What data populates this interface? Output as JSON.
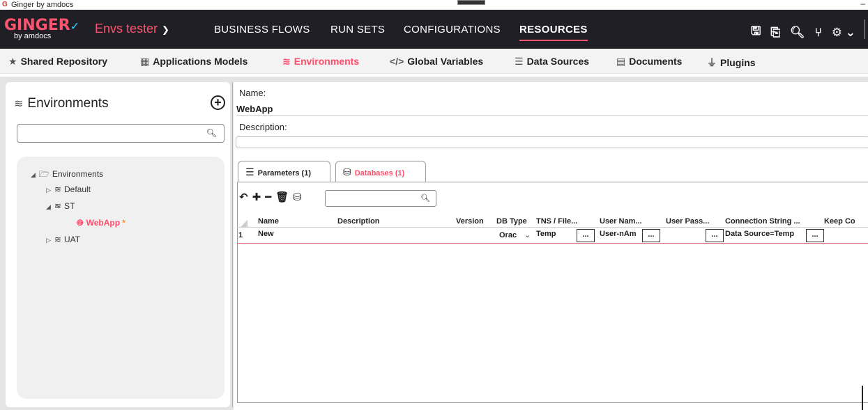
{
  "window": {
    "title": "Ginger by amdocs",
    "minimize": "–"
  },
  "brand": {
    "name": "GINGER",
    "tagline": "by amdocs"
  },
  "env_selector": {
    "value": "Envs tester"
  },
  "main_nav": {
    "items": [
      "BUSINESS FLOWS",
      "RUN SETS",
      "CONFIGURATIONS",
      "RESOURCES"
    ],
    "active": "RESOURCES"
  },
  "sub_nav": {
    "items": [
      "Shared Repository",
      "Applications Models",
      "Environments",
      "Global  Variables",
      "Data Sources",
      "Documents",
      "Plugins"
    ],
    "active": "Environments"
  },
  "left_panel": {
    "title": "Environments",
    "search_placeholder": "",
    "tree": {
      "root": "Environments",
      "children": [
        "Default",
        "ST",
        "WebApp",
        "UAT"
      ],
      "selected": "WebApp",
      "modified_marker": "*"
    }
  },
  "details": {
    "name_label": "Name:",
    "name_value": "WebApp",
    "description_label": "Description:",
    "description_value": ""
  },
  "tabs": [
    {
      "label": "Parameters (1)",
      "active": false
    },
    {
      "label": "Databases (1)",
      "active": true
    }
  ],
  "grid": {
    "columns": [
      "Name",
      "Description",
      "Version",
      "DB Type",
      "TNS / File...",
      "User Nam...",
      "User Pass...",
      "Connection String ...",
      "Keep Co"
    ],
    "rows": [
      {
        "index": "1",
        "name": "New",
        "description": "",
        "version": "",
        "db_type": "Orac",
        "tns": "Temp",
        "user_name": "User-nAm",
        "user_password": "",
        "connection_string": "Data Source=Temp",
        "button_label": "..."
      }
    ]
  },
  "colors": {
    "accent": "#ff4c6a",
    "nav_bg": "#1f1f25",
    "brand": "#ff5470"
  }
}
